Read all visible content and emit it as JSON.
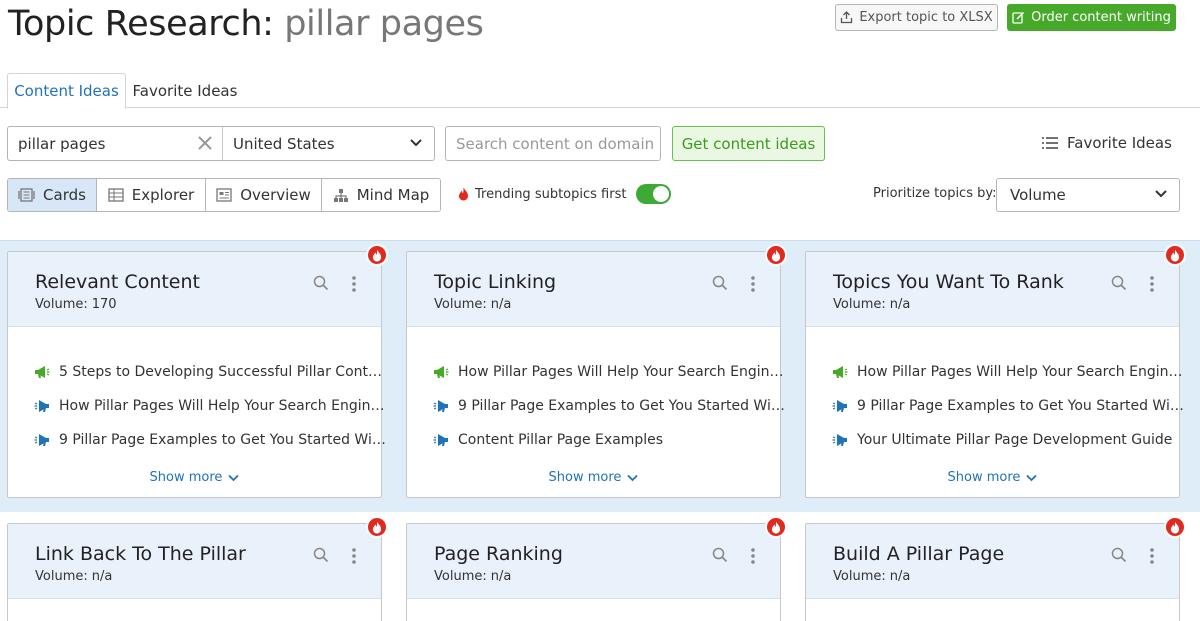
{
  "header": {
    "title_prefix": "Topic Research:",
    "title_topic": "pillar pages",
    "export_label": "Export topic to XLSX",
    "order_label": "Order content writing"
  },
  "tabs": [
    {
      "label": "Content Ideas",
      "active": true
    },
    {
      "label": "Favorite Ideas",
      "active": false
    }
  ],
  "search": {
    "keyword_value": "pillar pages",
    "country_value": "United States",
    "domain_placeholder": "Search content on domain",
    "get_ideas_label": "Get content ideas",
    "favorite_link_label": "Favorite Ideas"
  },
  "views": [
    {
      "label": "Cards",
      "icon": "cards-icon",
      "active": true
    },
    {
      "label": "Explorer",
      "icon": "table-icon",
      "active": false
    },
    {
      "label": "Overview",
      "icon": "overview-icon",
      "active": false
    },
    {
      "label": "Mind Map",
      "icon": "mindmap-icon",
      "active": false
    }
  ],
  "trending": {
    "label": "Trending subtopics first",
    "enabled": true
  },
  "prioritize": {
    "label": "Prioritize topics by:",
    "value": "Volume"
  },
  "cards": [
    {
      "title": "Relevant Content",
      "volume_label": "Volume:",
      "volume": "170",
      "items": [
        {
          "text": "5 Steps to Developing Successful Pillar Cont…",
          "icon": "megaphone-green-icon"
        },
        {
          "text": "How Pillar Pages Will Help Your Search Engin…",
          "icon": "megaphone-blue-icon"
        },
        {
          "text": "9 Pillar Page Examples to Get You Started Wi…",
          "icon": "megaphone-blue-icon"
        }
      ],
      "show_more": "Show more"
    },
    {
      "title": "Topic Linking",
      "volume_label": "Volume:",
      "volume": "n/a",
      "items": [
        {
          "text": "How Pillar Pages Will Help Your Search Engin…",
          "icon": "megaphone-green-icon"
        },
        {
          "text": "9 Pillar Page Examples to Get You Started Wi…",
          "icon": "megaphone-blue-icon"
        },
        {
          "text": "Content Pillar Page Examples",
          "icon": "megaphone-blue-icon"
        }
      ],
      "show_more": "Show more"
    },
    {
      "title": "Topics You Want To Rank",
      "volume_label": "Volume:",
      "volume": "n/a",
      "items": [
        {
          "text": "How Pillar Pages Will Help Your Search Engin…",
          "icon": "megaphone-green-icon"
        },
        {
          "text": "9 Pillar Page Examples to Get You Started Wi…",
          "icon": "megaphone-blue-icon"
        },
        {
          "text": "Your Ultimate Pillar Page Development Guide",
          "icon": "megaphone-blue-icon"
        }
      ],
      "show_more": "Show more"
    },
    {
      "title": "Link Back To The Pillar",
      "volume_label": "Volume:",
      "volume": "n/a"
    },
    {
      "title": "Page Ranking",
      "volume_label": "Volume:",
      "volume": "n/a"
    },
    {
      "title": "Build A Pillar Page",
      "volume_label": "Volume:",
      "volume": "n/a"
    }
  ],
  "colors": {
    "accent_blue": "#2173b8",
    "brand_green": "#46a929",
    "trend_red": "#e02a1f",
    "band_bg": "#dfedf9"
  }
}
